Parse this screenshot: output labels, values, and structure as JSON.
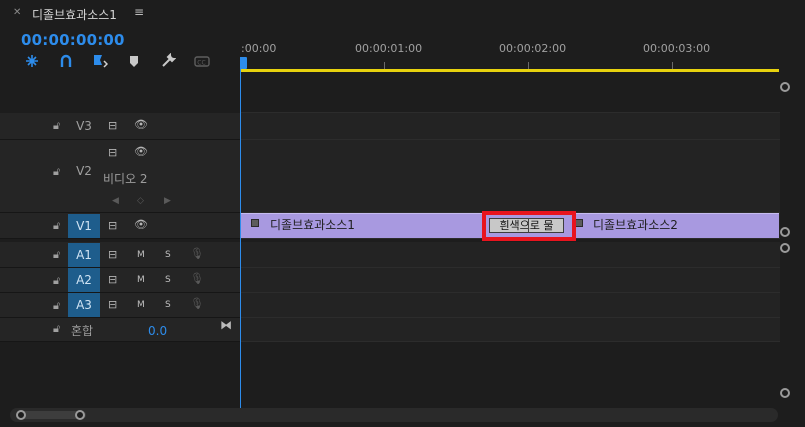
{
  "tab": {
    "close_icon": "close-icon",
    "title": "디졸브효과소스1",
    "menu_icon": "hamburger-menu-icon"
  },
  "timecode": "00:00:00:00",
  "toolbar": [
    "snap-icon",
    "linked-selection-icon",
    "add-marker-icon",
    "marker-icon",
    "wrench-icon",
    "captions-icon"
  ],
  "ruler": {
    "labels": [
      ":00:00",
      "00:00:01:00",
      "00:00:02:00",
      "00:00:03:00"
    ]
  },
  "tracks": {
    "v3": {
      "name": "V3"
    },
    "v2": {
      "name": "V2",
      "sublabel": "비디오 2"
    },
    "v1": {
      "name": "V1"
    },
    "a1": {
      "name": "A1",
      "m": "M",
      "s": "S"
    },
    "a2": {
      "name": "A2",
      "m": "M",
      "s": "S"
    },
    "a3": {
      "name": "A3",
      "m": "M",
      "s": "S"
    },
    "mix": {
      "name": "혼합",
      "volume": "0.0"
    }
  },
  "clips": {
    "clip1": {
      "title": "디졸브효과소스1"
    },
    "clip2": {
      "title": "디졸브효과소스2"
    },
    "transition": {
      "label": "흰색으로 물"
    }
  },
  "colors": {
    "accent": "#2d8ceb",
    "clip": "#a899e0",
    "workarea": "#e7d20e",
    "highlight": "#e8141e"
  }
}
